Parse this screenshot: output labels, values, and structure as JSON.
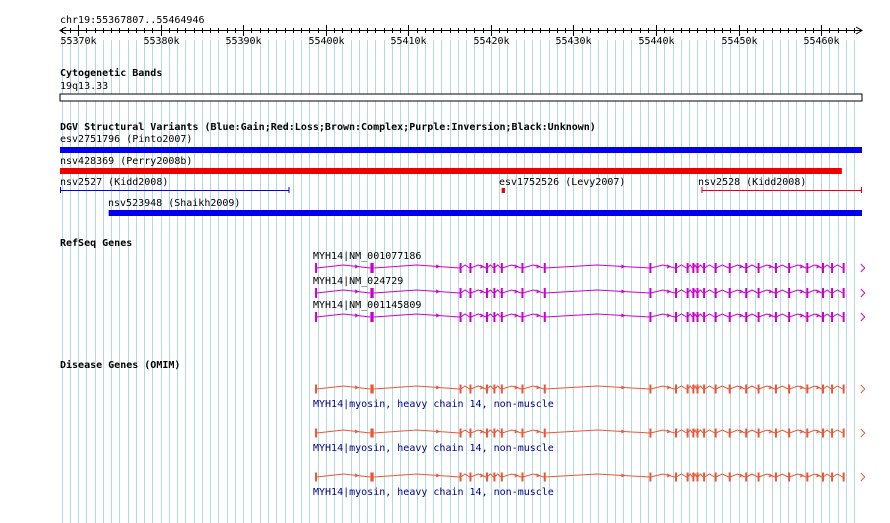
{
  "ruler": {
    "location": "chr19:55367807..55464946",
    "start": 55367807,
    "end": 55464946,
    "ticks": [
      "55370k",
      "55380k",
      "55390k",
      "55400k",
      "55410k",
      "55420k",
      "55430k",
      "55440k",
      "55450k",
      "55460k"
    ],
    "tick_values": [
      55370000,
      55380000,
      55390000,
      55400000,
      55410000,
      55420000,
      55430000,
      55440000,
      55450000,
      55460000
    ]
  },
  "tracks": {
    "cytoband": {
      "title": "Cytogenetic Bands",
      "band": "19q13.33"
    },
    "dgv": {
      "title": "DGV Structural Variants (Blue:Gain;Red:Loss;Brown:Complex;Purple:Inversion;Black:Unknown)",
      "colors": {
        "gain": "#0000ee",
        "loss": "#ee0000"
      },
      "features": [
        {
          "label": "esv2751796 (Pinto2007)",
          "type": "gain",
          "start": 55367807,
          "end": 55464946
        },
        {
          "label": "nsv428369 (Perry2008b)",
          "type": "loss",
          "start": 55367807,
          "end": 55462500
        },
        {
          "label": "nsv2527 (Kidd2008)",
          "type": "gain",
          "start": 55367807,
          "end": 55395600
        },
        {
          "label": "esv1752526 (Levy2007)",
          "type": "loss",
          "start": 55421300,
          "end": 55421700
        },
        {
          "label": "nsv2528 (Kidd2008)",
          "type": "loss",
          "start": 55445500,
          "end": 55464946
        },
        {
          "label": "nsv523948 (Shaikh2009)",
          "type": "gain",
          "start": 55373700,
          "end": 55464946
        }
      ]
    },
    "refseq": {
      "title": "RefSeq Genes",
      "color": "#cc00cc",
      "transcripts": [
        {
          "label": "MYH14|NM_001077186"
        },
        {
          "label": "MYH14|NM_024729"
        },
        {
          "label": "MYH14|NM_001145809"
        }
      ]
    },
    "omim": {
      "title": "Disease Genes (OMIM)",
      "color": "#ee5533",
      "entries": [
        {
          "label": "MYH14|myosin, heavy chain 14, non-muscle"
        },
        {
          "label": "MYH14|myosin, heavy chain 14, non-muscle"
        },
        {
          "label": "MYH14|myosin, heavy chain 14, non-muscle"
        }
      ]
    }
  },
  "gene": {
    "start": 55398700,
    "end": 55464800,
    "exons": [
      [
        55398700,
        55398900
      ],
      [
        55405400,
        55405800
      ],
      [
        55416200,
        55416350
      ],
      [
        55417400,
        55417550
      ],
      [
        55419400,
        55419550
      ],
      [
        55420300,
        55420450
      ],
      [
        55421200,
        55421350
      ],
      [
        55423700,
        55423850
      ],
      [
        55426400,
        55426550
      ],
      [
        55439200,
        55439350
      ],
      [
        55442300,
        55442450
      ],
      [
        55443700,
        55443850
      ],
      [
        55444400,
        55444550
      ],
      [
        55444900,
        55445050
      ],
      [
        55445700,
        55445850
      ],
      [
        55447100,
        55447250
      ],
      [
        55448800,
        55448950
      ],
      [
        55450800,
        55450950
      ],
      [
        55452300,
        55452450
      ],
      [
        55454400,
        55454550
      ],
      [
        55456000,
        55456150
      ],
      [
        55458200,
        55458350
      ],
      [
        55460100,
        55460250
      ],
      [
        55461200,
        55461350
      ],
      [
        55462600,
        55462750
      ]
    ]
  },
  "grid_color": "#b4d8e4"
}
